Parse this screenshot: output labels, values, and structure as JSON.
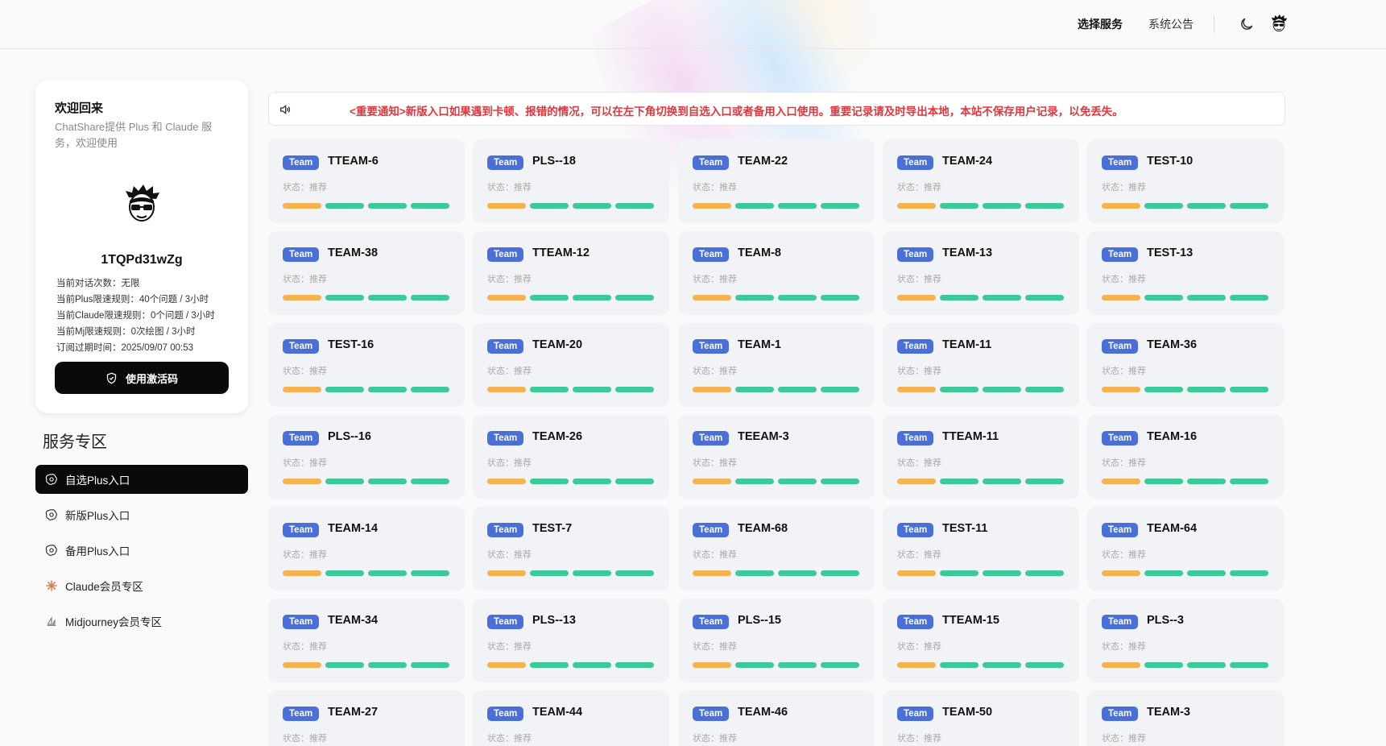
{
  "nav": {
    "select_service": "选择服务",
    "announcements": "系统公告",
    "theme_icon": "moon-icon",
    "avatar_icon": "avatar-icon"
  },
  "profile": {
    "welcome_title": "欢迎回来",
    "welcome_sub": "ChatShare提供 Plus 和 Claude 服务，欢迎使用",
    "username": "1TQPd31wZg",
    "info": [
      "当前对话次数：无限",
      "当前Plus限速规则：40个问题 / 3小时",
      "当前Claude限速规则：0个问题 / 3小时",
      "当前Mj限速规则：0次绘图 / 3小时",
      "订阅过期时间：2025/09/07 00:53"
    ],
    "activate_label": "使用激活码"
  },
  "services": {
    "title": "服务专区",
    "items": [
      {
        "label": "自选Plus入口",
        "icon": "openai-icon"
      },
      {
        "label": "新版Plus入口",
        "icon": "openai-icon"
      },
      {
        "label": "备用Plus入口",
        "icon": "openai-icon"
      },
      {
        "label": "Claude会员专区",
        "icon": "claude-icon"
      },
      {
        "label": "Midjourney会员专区",
        "icon": "midjourney-icon"
      }
    ]
  },
  "notice": {
    "icon": "speaker-icon",
    "text": "<重要通知>新版入口如果遇到卡顿、报错的情况，可以在左下角切换到自选入口或者备用入口使用。重要记录请及时导出本地，本站不保存用户记录，以免丢失。"
  },
  "card_badge": "Team",
  "card_status": "状态：推荐",
  "colors": {
    "accent_blue": "#4a6fd8",
    "bar_orange": "#f4b350",
    "bar_green": "#3ec998",
    "notice_red": "#e0363d"
  },
  "accounts": [
    "TTEAM-6",
    "PLS--18",
    "TEAM-22",
    "TEAM-24",
    "TEST-10",
    "TEAM-38",
    "TTEAM-12",
    "TEAM-8",
    "TEAM-13",
    "TEST-13",
    "TEST-16",
    "TEAM-20",
    "TEAM-1",
    "TEAM-11",
    "TEAM-36",
    "PLS--16",
    "TEAM-26",
    "TEEAM-3",
    "TTEAM-11",
    "TEAM-16",
    "TEAM-14",
    "TEST-7",
    "TEAM-68",
    "TEST-11",
    "TEAM-64",
    "TEAM-34",
    "PLS--13",
    "PLS--15",
    "TTEAM-15",
    "PLS--3",
    "TEAM-27",
    "TEAM-44",
    "TEAM-46",
    "TEAM-50",
    "TEAM-3"
  ]
}
